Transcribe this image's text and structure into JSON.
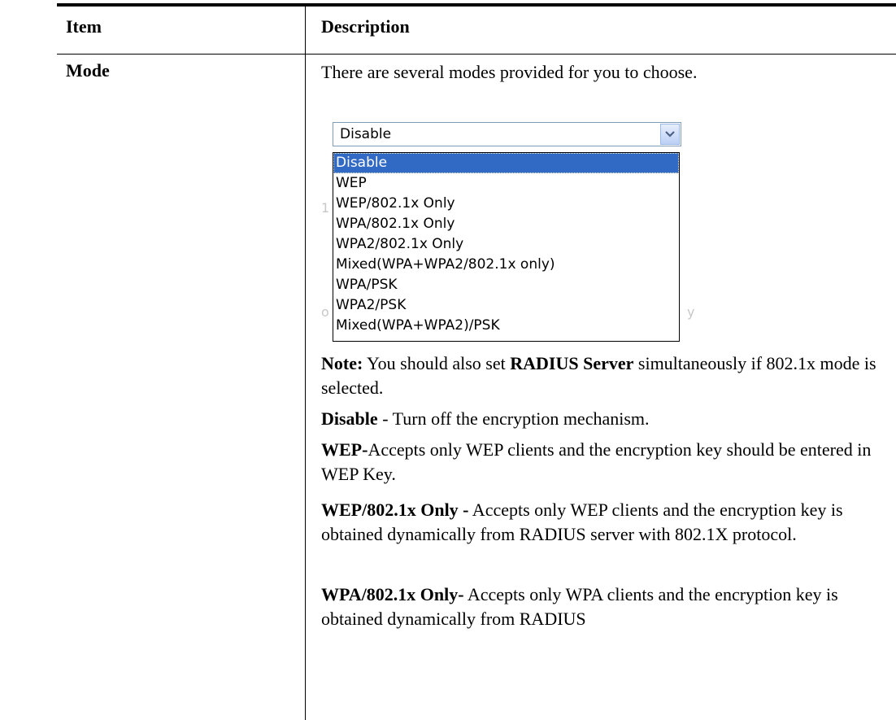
{
  "table": {
    "headers": {
      "item": "Item",
      "description": "Description"
    },
    "row": {
      "item": "Mode",
      "intro": "There are several modes provided for you to choose.",
      "select": {
        "current_value": "Disable",
        "options": [
          "Disable",
          "WEP",
          "WEP/802.1x Only",
          "WPA/802.1x Only",
          "WPA2/802.1x Only",
          "Mixed(WPA+WPA2/802.1x only)",
          "WPA/PSK",
          "WPA2/PSK",
          "Mixed(WPA+WPA2)/PSK"
        ],
        "highlighted_index": 0
      },
      "paragraphs": {
        "note_label": "Note:",
        "note_text_1": " You should also set ",
        "note_bold": "RADIUS Server",
        "note_text_2": " simultaneously if 802.1x mode is selected.",
        "disable_label": "Disable",
        "disable_text": " - Turn off the encryption mechanism.",
        "wep_label": "WEP-",
        "wep_text": "Accepts only WEP clients and the encryption key should be entered in WEP Key.",
        "wep8021x_label": "WEP/802.1x Only -",
        "wep8021x_text": " Accepts only WEP clients and the encryption key is obtained dynamically from RADIUS server with 802.1X protocol.",
        "wpa8021x_label": "WPA/802.1x Only-",
        "wpa8021x_text": " Accepts only WPA clients and the encryption key is obtained dynamically from RADIUS"
      }
    }
  },
  "colors": {
    "selection_bg": "#316ac5",
    "select_border": "#7f9db9"
  },
  "icons": {
    "dropdown": "chevron-down-icon"
  }
}
